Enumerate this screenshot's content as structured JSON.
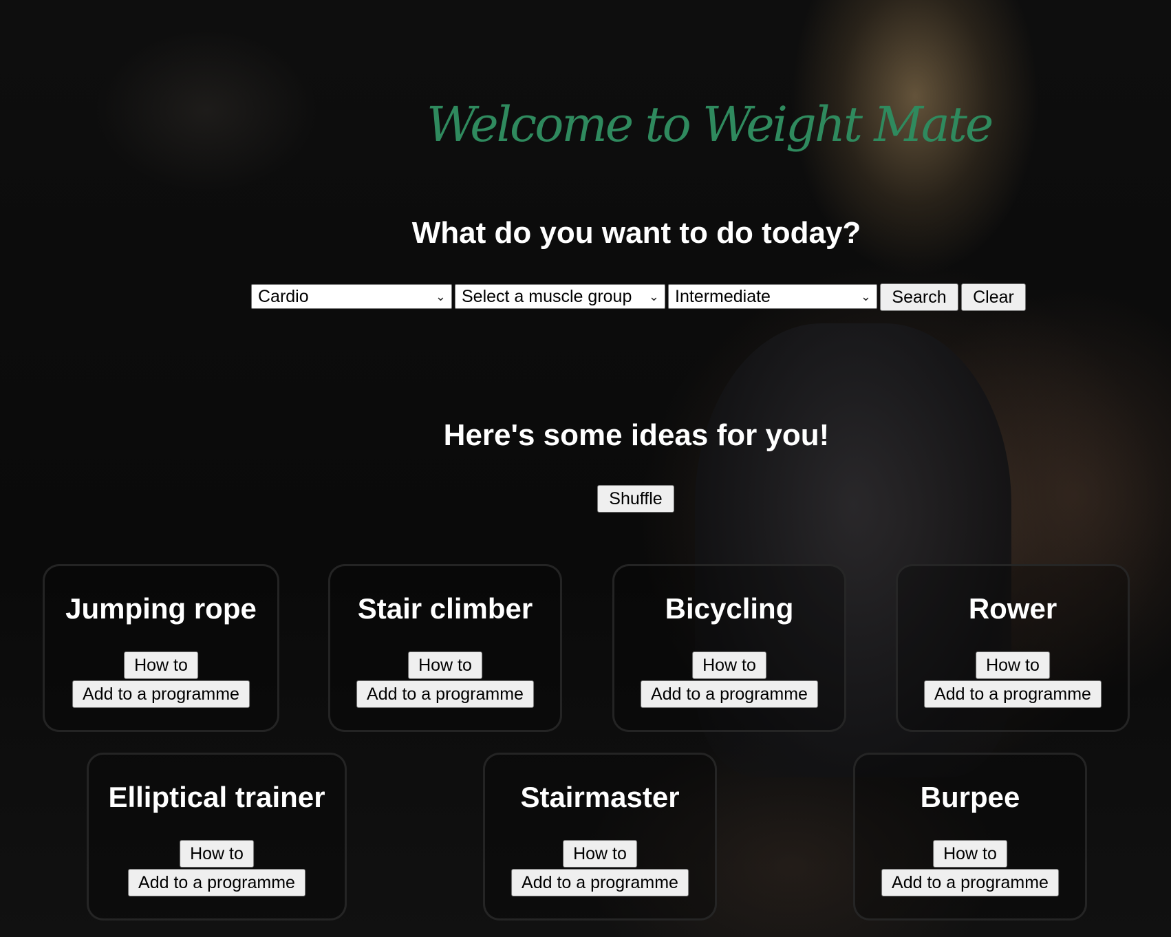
{
  "app": {
    "logo_text": "Welcome to Weight Mate",
    "accent_color": "#2f8a5e"
  },
  "search": {
    "question": "What do you want to do today?",
    "category_value": "Cardio",
    "muscle_value": "Select a muscle group",
    "level_value": "Intermediate",
    "search_label": "Search",
    "clear_label": "Clear"
  },
  "ideas": {
    "heading": "Here's some ideas for you!",
    "shuffle_label": "Shuffle",
    "cards": [
      {
        "title": "Jumping rope",
        "howto_label": "How to",
        "add_label": "Add to a programme"
      },
      {
        "title": "Stair climber",
        "howto_label": "How to",
        "add_label": "Add to a programme"
      },
      {
        "title": "Bicycling",
        "howto_label": "How to",
        "add_label": "Add to a programme"
      },
      {
        "title": "Rower",
        "howto_label": "How to",
        "add_label": "Add to a programme"
      },
      {
        "title": "Elliptical trainer",
        "howto_label": "How to",
        "add_label": "Add to a programme"
      },
      {
        "title": "Stairmaster",
        "howto_label": "How to",
        "add_label": "Add to a programme"
      },
      {
        "title": "Burpee",
        "howto_label": "How to",
        "add_label": "Add to a programme"
      }
    ]
  }
}
